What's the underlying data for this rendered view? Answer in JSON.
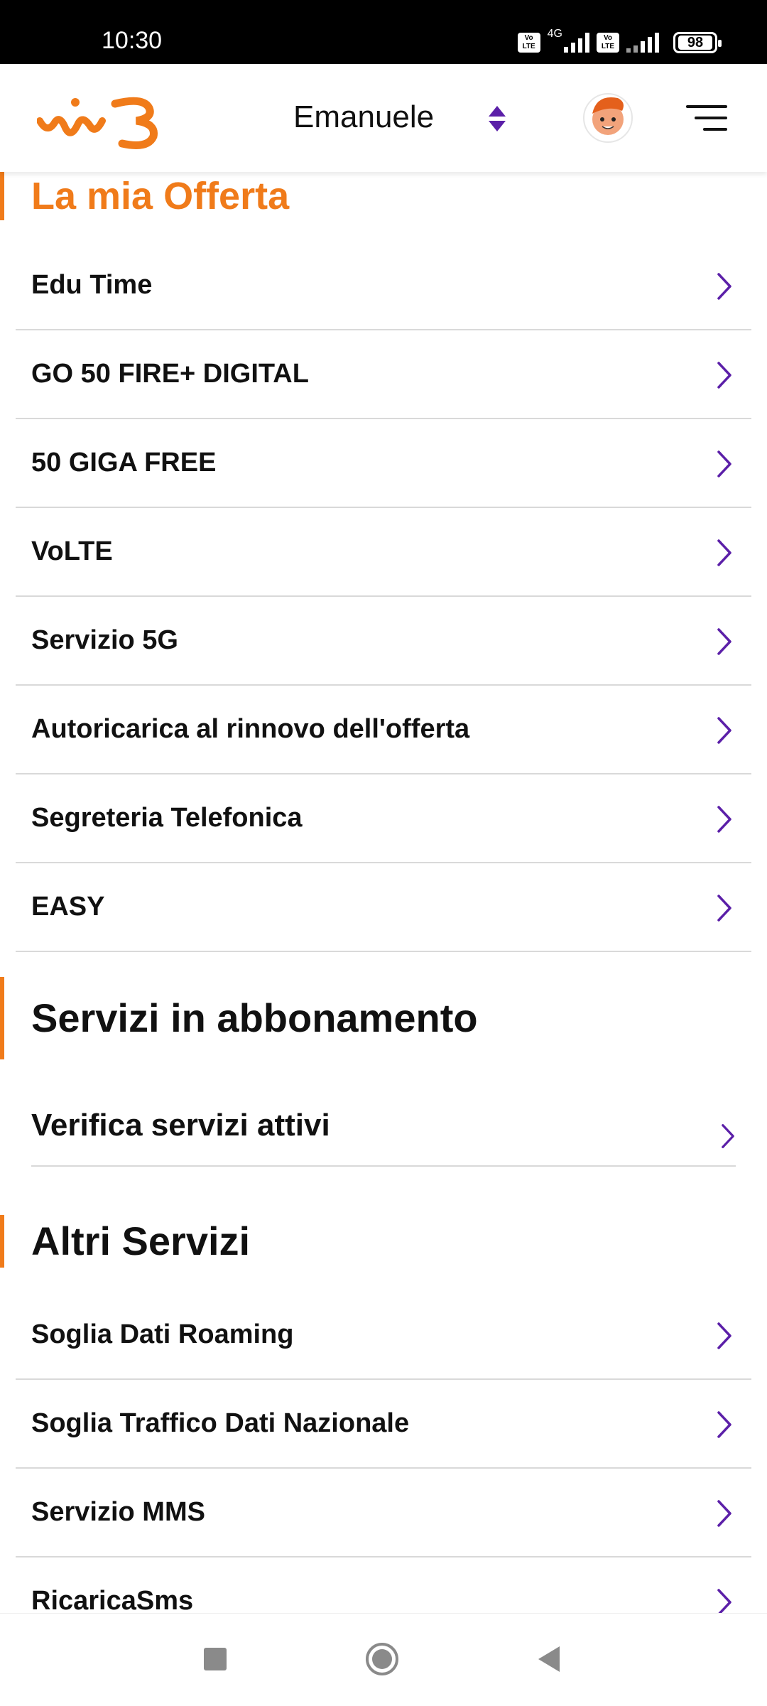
{
  "status_bar": {
    "time": "10:30",
    "network_type": "4G",
    "volte_label_1": "Vo",
    "volte_label_2": "LTE",
    "battery": "98"
  },
  "header": {
    "user_name": "Emanuele",
    "brand_color": "#f07b1a",
    "accent_color": "#5b1fa8"
  },
  "sections": {
    "offer": {
      "title": "La mia Offerta",
      "items": [
        {
          "label": "Edu Time"
        },
        {
          "label": "GO 50 FIRE+ DIGITAL"
        },
        {
          "label": "50 GIGA FREE"
        },
        {
          "label": "VoLTE"
        },
        {
          "label": "Servizio 5G"
        },
        {
          "label": "Autoricarica al rinnovo dell'offerta"
        },
        {
          "label": "Segreteria Telefonica"
        },
        {
          "label": "EASY"
        }
      ]
    },
    "subscriptions": {
      "title": "Servizi in abbonamento",
      "items": [
        {
          "label": "Verifica servizi attivi"
        }
      ]
    },
    "other": {
      "title": "Altri Servizi",
      "items": [
        {
          "label": "Soglia Dati Roaming"
        },
        {
          "label": "Soglia Traffico Dati Nazionale"
        },
        {
          "label": "Servizio MMS"
        },
        {
          "label": "RicaricaSms"
        }
      ]
    }
  }
}
